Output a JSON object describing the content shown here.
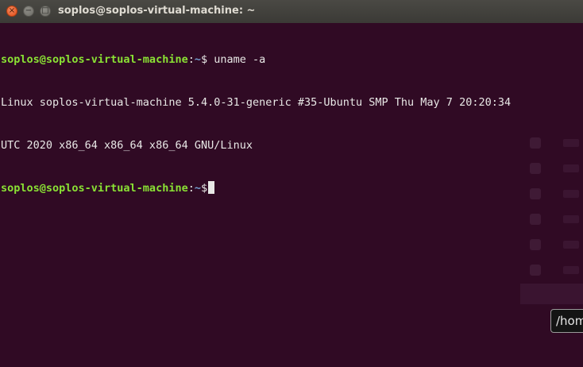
{
  "window": {
    "title": "soplos@soplos-virtual-machine: ~",
    "close_glyph": "×",
    "minimize_glyph": "−",
    "maximize_glyph": "□"
  },
  "terminal": {
    "prompt_user_host": "soplos@soplos-virtual-machine",
    "prompt_sep": ":",
    "prompt_path": "~",
    "prompt_symbol": "$",
    "command": " uname -a",
    "output_lines": [
      "Linux soplos-virtual-machine 5.4.0-31-generic #35-Ubuntu SMP Thu May 7 20:20:34",
      "UTC 2020 x86_64 x86_64 x86_64 GNU/Linux"
    ],
    "colors": {
      "background": "#300a24",
      "user_host": "#8ae234",
      "path": "#729fcf",
      "text": "#e8e8e6"
    }
  },
  "tooltip": {
    "text": "/hom"
  }
}
